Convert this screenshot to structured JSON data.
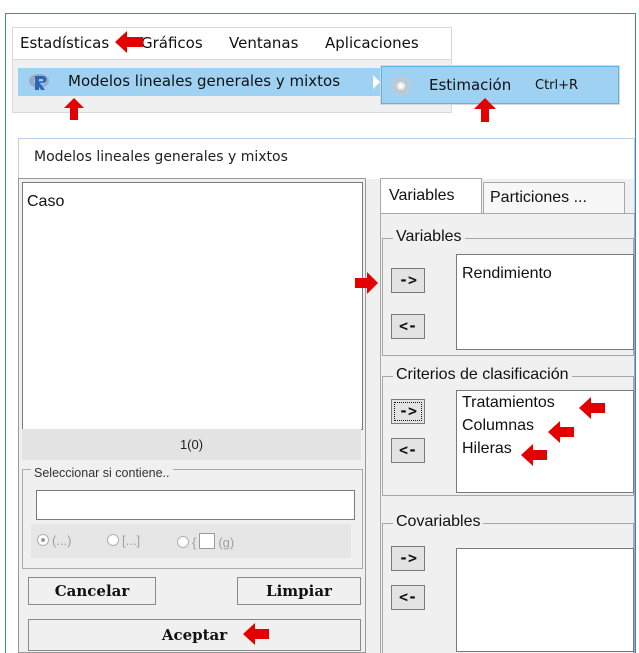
{
  "menubar": {
    "items": [
      "Estadísticas",
      "Gráficos",
      "Ventanas",
      "Aplicaciones"
    ]
  },
  "submenu": {
    "item_label": "Modelos lineales generales y mixtos",
    "sub_label": "Estimación",
    "sub_shortcut": "Ctrl+R"
  },
  "dialog": {
    "title": "Modelos lineales generales y mixtos",
    "variables_list": [
      "Caso"
    ],
    "count": "1(0)",
    "select_group_label": "Seleccionar si contiene..",
    "select_input_value": "",
    "options": [
      "(...)",
      "[...]",
      "{",
      "(g)"
    ],
    "buttons": {
      "cancel": "Cancelar",
      "clear": "Limpiar",
      "accept": "Aceptar"
    },
    "tabs": [
      "Variables",
      "Particiones ..."
    ],
    "groups": {
      "variables": {
        "label": "Variables",
        "items": [
          "Rendimiento"
        ]
      },
      "criterios": {
        "label": "Criterios de clasificación",
        "items": [
          "Tratamientos",
          "Columnas",
          "Hileras"
        ]
      },
      "covariables": {
        "label": "Covariables",
        "items": []
      }
    },
    "move_right": "->",
    "move_left": "<-"
  },
  "colors": {
    "highlight": "#9fd2f2",
    "annotation_arrow": "#e50000"
  }
}
